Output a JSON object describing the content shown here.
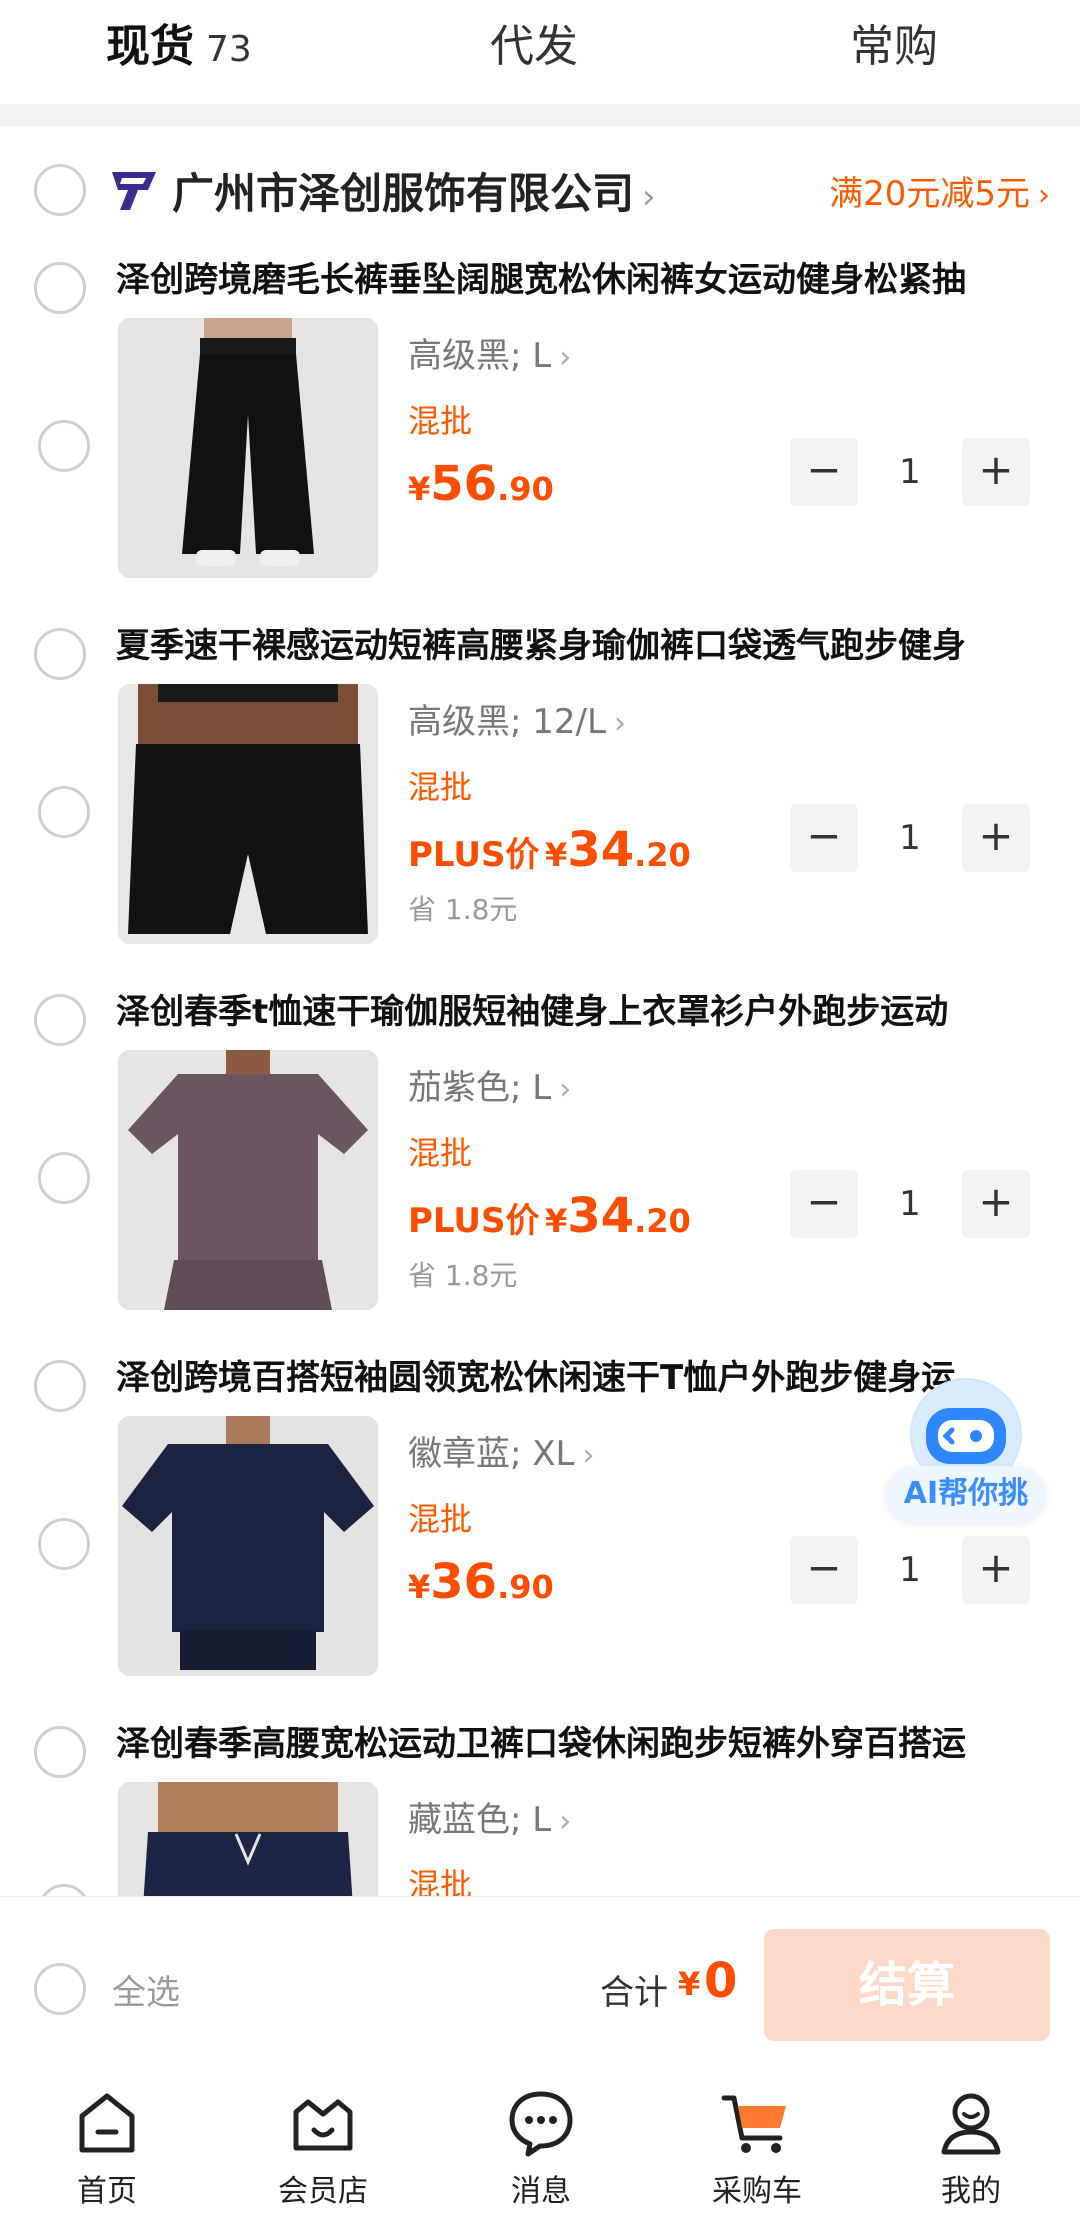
{
  "tabs": [
    {
      "label": "现货",
      "count": "73",
      "active": true
    },
    {
      "label": "代发",
      "active": false
    },
    {
      "label": "常购",
      "active": false
    }
  ],
  "shop": {
    "name": "广州市泽创服饰有限公司",
    "promo": "满20元减5元"
  },
  "items": [
    {
      "title": "泽创跨境磨毛长裤垂坠阔腿宽松休闲裤女运动健身松紧抽",
      "spec": "高级黑; L",
      "tag": "混批",
      "plus_label": "",
      "price_yen": "¥",
      "price_int": "56",
      "price_dec": ".90",
      "save": "",
      "qty": "1",
      "image_icon": "pants-icon"
    },
    {
      "title": "夏季速干裸感运动短裤高腰紧身瑜伽裤口袋透气跑步健身",
      "spec": "高级黑; 12/L",
      "tag": "混批",
      "plus_label": "PLUS价",
      "price_yen": "¥",
      "price_int": "34",
      "price_dec": ".20",
      "save": "省 1.8元",
      "qty": "1",
      "image_icon": "shorts-icon"
    },
    {
      "title": "泽创春季t恤速干瑜伽服短袖健身上衣罩衫户外跑步运动",
      "spec": "茄紫色; L",
      "tag": "混批",
      "plus_label": "PLUS价",
      "price_yen": "¥",
      "price_int": "34",
      "price_dec": ".20",
      "save": "省 1.8元",
      "qty": "1",
      "image_icon": "tshirt-icon"
    },
    {
      "title": "泽创跨境百搭短袖圆领宽松休闲速干T恤户外跑步健身运",
      "spec": "徽章蓝; XL",
      "tag": "混批",
      "plus_label": "",
      "price_yen": "¥",
      "price_int": "36",
      "price_dec": ".90",
      "save": "",
      "qty": "1",
      "image_icon": "tshirt-icon"
    },
    {
      "title": "泽创春季高腰宽松运动卫裤口袋休闲跑步短裤外穿百搭运",
      "spec": "藏蓝色; L",
      "tag": "混批",
      "plus_label": "",
      "price_yen": "",
      "price_int": "",
      "price_dec": "",
      "save": "",
      "qty": "",
      "image_icon": "shorts-icon"
    }
  ],
  "ai_float": {
    "label": "AI帮你挑",
    "icon": "ai-robot-icon"
  },
  "checkout": {
    "select_all": "全选",
    "total_label": "合计",
    "total_yen": "¥",
    "total_value": "0",
    "button": "结算"
  },
  "nav": [
    {
      "label": "首页",
      "icon": "home-icon"
    },
    {
      "label": "会员店",
      "icon": "member-store-icon"
    },
    {
      "label": "消息",
      "icon": "message-icon"
    },
    {
      "label": "采购车",
      "icon": "cart-icon",
      "active": true
    },
    {
      "label": "我的",
      "icon": "profile-icon"
    }
  ],
  "colors": {
    "accent": "#ff5a00",
    "price": "#ff4d00",
    "checkout_disabled": "#ffd9c7",
    "ai_blue": "#3a8cff"
  }
}
